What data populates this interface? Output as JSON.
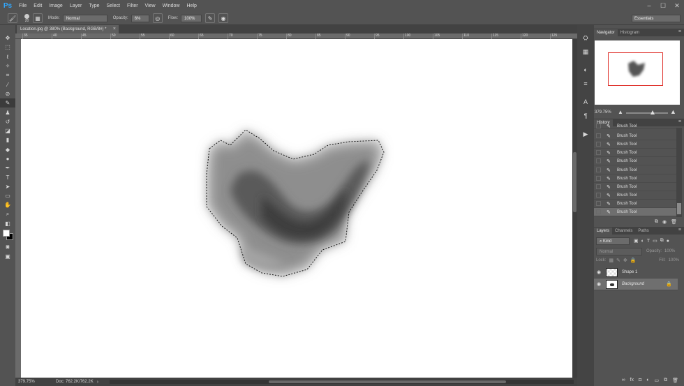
{
  "app": {
    "logo": "Ps"
  },
  "menu": [
    "File",
    "Edit",
    "Image",
    "Layer",
    "Type",
    "Select",
    "Filter",
    "View",
    "Window",
    "Help"
  ],
  "window_controls": [
    "–",
    "☐",
    "✕"
  ],
  "options": {
    "brush_size": "20",
    "mode_label": "Mode:",
    "mode_value": "Normal",
    "opacity_label": "Opacity:",
    "opacity_value": "6%",
    "flow_label": "Flow:",
    "flow_value": "100%",
    "workspace": "Essentials"
  },
  "document": {
    "tab_title": "Location.jpg @ 380% (Background, RGB/8#) *",
    "ruler_ticks": [
      "35",
      "40",
      "45",
      "50",
      "55",
      "60",
      "65",
      "70",
      "75",
      "80",
      "85",
      "90",
      "95",
      "100",
      "105",
      "110",
      "115",
      "120",
      "125",
      "130"
    ]
  },
  "status": {
    "zoom": "379.75%",
    "doc": "Doc: 762.2K/762.2K"
  },
  "panels": {
    "navigator_tabs": [
      "Navigator",
      "Histogram"
    ],
    "navigator_zoom": "379.75%",
    "history_tab": "History",
    "history_items": [
      "Brush Tool",
      "Brush Tool",
      "Brush Tool",
      "Brush Tool",
      "Brush Tool",
      "Brush Tool",
      "Brush Tool",
      "Brush Tool",
      "Brush Tool",
      "Brush Tool",
      "Brush Tool"
    ],
    "layers_tabs": [
      "Layers",
      "Channels",
      "Paths"
    ],
    "layers_filter": "Kind",
    "blend_mode": "Normal",
    "layer_opacity_label": "Opacity:",
    "layer_opacity": "100%",
    "lock_label": "Lock:",
    "fill_label": "Fill:",
    "fill": "100%",
    "layers": [
      {
        "name": "Shape 1"
      },
      {
        "name": "Background"
      }
    ]
  },
  "colors": {
    "accent": "#31a8ff",
    "nav_box": "#e0352f"
  }
}
